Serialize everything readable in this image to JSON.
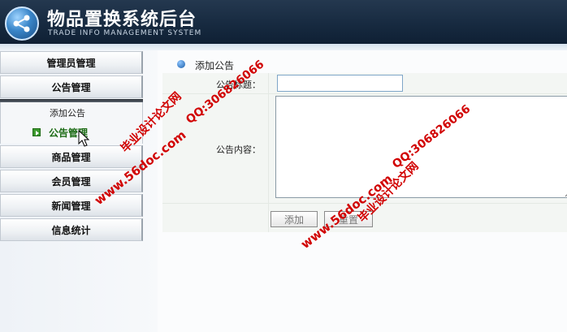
{
  "app": {
    "title": "物品置换系统后台",
    "subtitle": "TRADE INFO MANAGEMENT SYSTEM"
  },
  "sidebar": {
    "items": [
      {
        "label": "管理员管理"
      },
      {
        "label": "公告管理"
      },
      {
        "label": "商品管理"
      },
      {
        "label": "会员管理"
      },
      {
        "label": "新闻管理"
      },
      {
        "label": "信息统计"
      }
    ],
    "submenu": [
      {
        "label": "添加公告"
      },
      {
        "label": "公告管理"
      }
    ]
  },
  "main": {
    "breadcrumb": "添加公告",
    "form": {
      "title_label": "公告标题：",
      "title_value": "",
      "content_label": "公告内容：",
      "content_value": "",
      "add_button": "添加",
      "reset_button": "重置"
    }
  },
  "watermarks": {
    "site_1": "www.56doc.com",
    "qq_1": "QQ:306826066",
    "name_1": "毕业设计论文网",
    "site_2": "www.56doc.com",
    "qq_2": "QQ:306826066",
    "name_2": "毕业设计论文网"
  },
  "colors": {
    "header": "#172a40",
    "active_menu": "#1b6b14",
    "watermark": "#d10000"
  }
}
